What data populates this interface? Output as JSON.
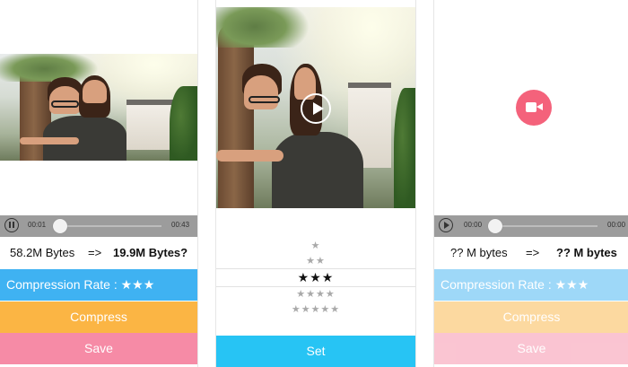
{
  "colors": {
    "blue": "#3fb2f2",
    "orange": "#fbb544",
    "pink": "#f68ba6",
    "cyan": "#27c4f4",
    "player_gray": "#9c9c9c",
    "camera_pink": "#f4627b"
  },
  "panel1": {
    "player": {
      "state_icon": "pause-icon",
      "current_time": "00:01",
      "total_time": "00:43",
      "progress": 0.06
    },
    "original_size": "58.2M Bytes",
    "arrow": "=>",
    "compressed_size": "19.9M Bytes?",
    "compression_label": "Compression Rate :",
    "compression_stars": "★★★",
    "compress_label": "Compress",
    "save_label": "Save"
  },
  "panel2": {
    "play_icon": "play-icon",
    "rates": [
      "★",
      "★★",
      "★★★",
      "★★★★",
      "★★★★★"
    ],
    "selected_index": 2,
    "set_label": "Set"
  },
  "panel3": {
    "camera_icon": "video-camera-icon",
    "player": {
      "state_icon": "play-icon",
      "current_time": "00:00",
      "total_time": "00:00",
      "progress": 0.0
    },
    "original_size": "?? M bytes",
    "arrow": "=>",
    "compressed_size": "?? M bytes",
    "compression_label": "Compression Rate :",
    "compression_stars": "★★★",
    "compress_label": "Compress",
    "save_label": "Save"
  }
}
